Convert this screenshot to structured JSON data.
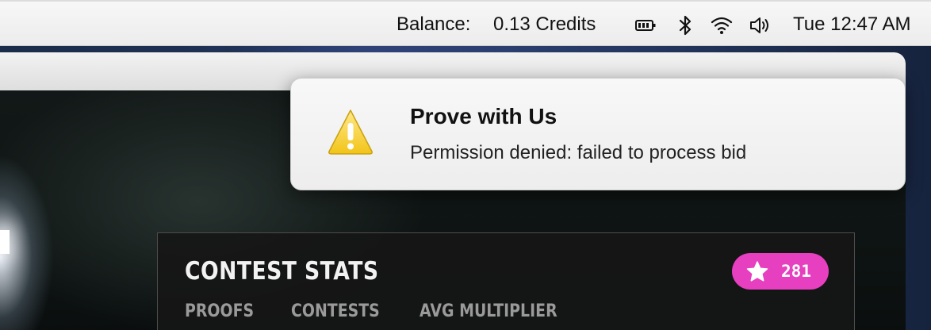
{
  "menubar": {
    "balance_label": "Balance:",
    "balance_value": "0.13 Credits",
    "status_icons": [
      "battery-icon",
      "bluetooth-icon",
      "wifi-icon",
      "volume-icon"
    ],
    "clock": "Tue 12:47 AM"
  },
  "notification": {
    "icon": "warning-icon",
    "title": "Prove with Us",
    "message": "Permission denied: failed to process bid"
  },
  "contest_stats": {
    "title": "CONTEST STATS",
    "badge_icon": "star-icon",
    "badge_value": "281",
    "badge_color": "#e63fbf",
    "tabs": [
      {
        "label": "PROOFS"
      },
      {
        "label": "CONTESTS"
      },
      {
        "label": "AVG MULTIPLIER"
      }
    ]
  }
}
